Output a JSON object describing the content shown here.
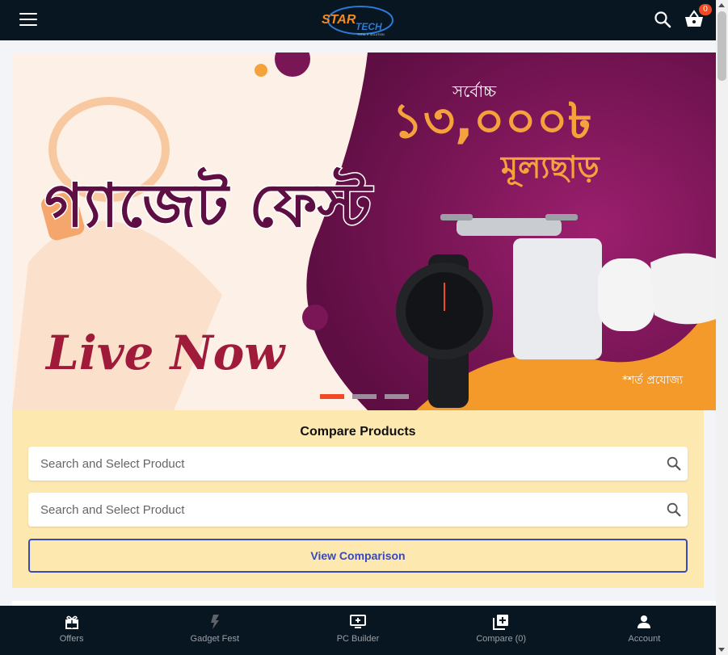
{
  "header": {
    "logo_text": "STAR TECH",
    "logo_tagline": "TOTAL IT SOLUTION",
    "cart_count": "0"
  },
  "banner": {
    "title_bn": "গ্যাজেট ফেস্ট",
    "live_text": "Live Now",
    "upto_bn": "সর্বোচ্চ",
    "discount_bn": "১৩,০০০৳",
    "discount_label_bn": "মূল্যছাড়",
    "terms_bn": "*শর্ত প্রযোজ্য",
    "slides": 3,
    "active_slide": 1
  },
  "compare": {
    "title": "Compare Products",
    "input1_placeholder": "Search and Select Product",
    "input2_placeholder": "Search and Select Product",
    "button_label": "View Comparison"
  },
  "bottom_nav": [
    {
      "label": "Offers",
      "icon": "gift-icon"
    },
    {
      "label": "Gadget Fest",
      "icon": "flash-icon"
    },
    {
      "label": "PC Builder",
      "icon": "pc-builder-icon"
    },
    {
      "label": "Compare (0)",
      "icon": "compare-icon"
    },
    {
      "label": "Account",
      "icon": "user-icon"
    }
  ],
  "colors": {
    "header_bg": "#081621",
    "accent": "#ef4a23",
    "compare_bg": "#fde8b0",
    "button_border": "#3749bb",
    "banner_purple": "#7a1655"
  }
}
